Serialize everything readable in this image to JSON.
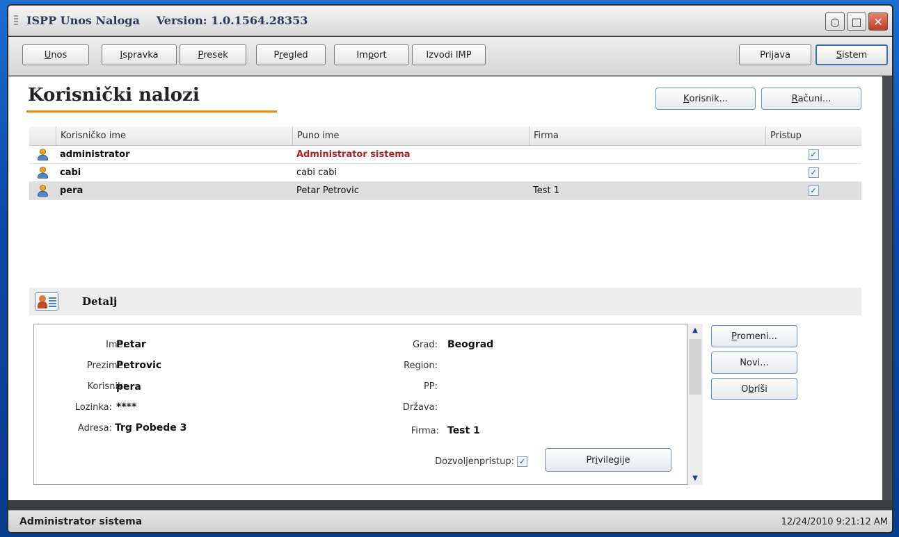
{
  "window": {
    "app_name": "ISPP Unos Naloga",
    "version": "Version: 1.0.1564.28353",
    "controls": {
      "minimize": "○",
      "maximize": "□",
      "close": "✕"
    }
  },
  "toolbar": {
    "unos": {
      "u": "U",
      "rest": "nos"
    },
    "ispravka": {
      "u": "I",
      "rest": "spravka"
    },
    "presek": {
      "u": "P",
      "rest": "resek"
    },
    "pregled": {
      "pre": "P",
      "u": "r",
      "rest": "egled"
    },
    "import": {
      "pre": "Im",
      "u": "p",
      "rest": "ort"
    },
    "izvodi": "Izvodi IMP",
    "prijava": {
      "pre": "Pri",
      "u": "j",
      "rest": "ava"
    },
    "sistem": {
      "u": "S",
      "rest": "istem"
    }
  },
  "page": {
    "title": "Korisnički nalozi",
    "korisnik_btn": {
      "u": "K",
      "rest": "orisnik..."
    },
    "racuni_btn": {
      "u": "R",
      "rest": "ačuni..."
    }
  },
  "grid": {
    "columns": [
      "Korisničko ime",
      "Puno ime",
      "Firma",
      "Pristup"
    ],
    "rows": [
      {
        "user": "administrator",
        "full_name": "Administrator sistema",
        "firm": "",
        "access": "✓"
      },
      {
        "user": "cabi",
        "full_name": "cabi cabi",
        "firm": "",
        "access": "✓"
      },
      {
        "user": "pera",
        "full_name": "Petar Petrovic",
        "firm": "Test 1",
        "access": "✓"
      }
    ]
  },
  "detail": {
    "title": "Detalj",
    "labels": {
      "ime": "Ime:",
      "prezime": "Prezime:",
      "korisnik": "Korisnik:",
      "lozinka": "Lozinka:",
      "adresa": "Adresa:",
      "grad": "Grad:",
      "region": "Region:",
      "pp": "PP:",
      "drzava": "Država:",
      "firma": "Firma:",
      "dozvoljen": "Dozvoljenpristup:"
    },
    "values": {
      "ime": "Petar",
      "prezime": "Petrovic",
      "korisnik": "pera",
      "lozinka": "****",
      "adresa": "Trg Pobede 3",
      "grad": "Beograd",
      "region": "",
      "pp": "",
      "drzava": "",
      "firma": "Test 1",
      "dozvoljen": "✓"
    },
    "privilegije": {
      "pre": "Pr",
      "u": "i",
      "rest": "vilegije"
    },
    "promeni": {
      "u": "P",
      "rest": "romeni..."
    },
    "novi": "Novi...",
    "obrisi": {
      "pre": "O",
      "u": "b",
      "rest": "riši"
    },
    "scroll_up": "▲",
    "scroll_down": "▼"
  },
  "status": {
    "user": "Administrator sistema",
    "time": "12/24/2010 9:21:12 AM"
  }
}
